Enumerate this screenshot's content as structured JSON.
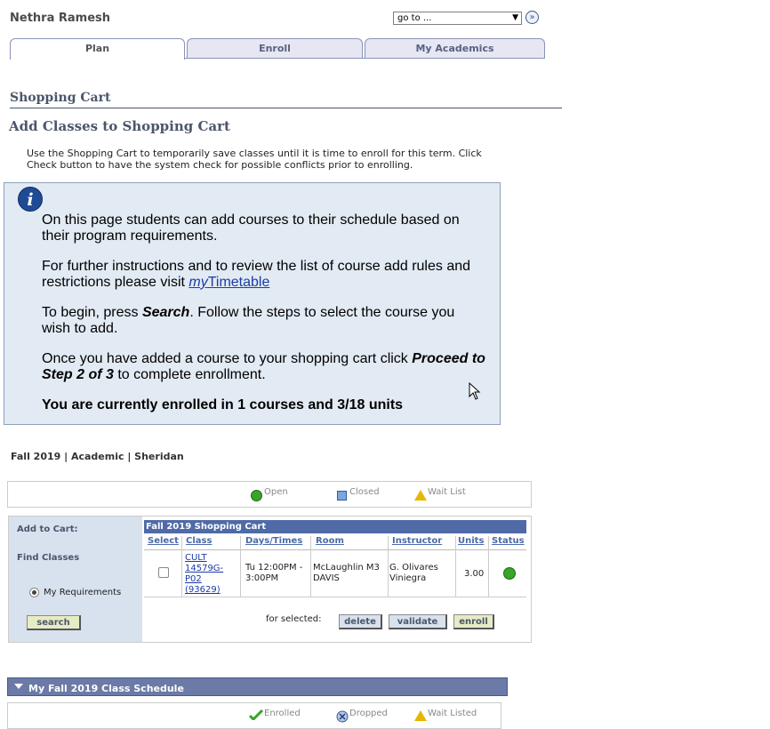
{
  "header": {
    "student_name": "Nethra Ramesh",
    "goto_label": "go to ...",
    "goto_button_glyph": "»"
  },
  "tabs": [
    {
      "label": "Plan",
      "active": true
    },
    {
      "label": "Enroll",
      "active": false
    },
    {
      "label": "My Academics",
      "active": false
    }
  ],
  "page": {
    "section_title": "Shopping Cart",
    "title": "Add Classes to Shopping Cart",
    "intro": "Use the Shopping Cart to temporarily save classes until it is time to enroll for this term.  Click Check button to have the system check for possible conflicts prior to enrolling."
  },
  "info": {
    "icon_glyph": "i",
    "p1": "On this page students can add courses to their schedule based on their program requirements.",
    "p2_before": "For further instructions and to review the list of course add rules and restrictions please visit ",
    "p2_link_italic": "my",
    "p2_link_rest": "Timetable",
    "p3_before": "To begin, press ",
    "p3_bold": "Search",
    "p3_after": ". Follow the steps to select the course you wish to add.",
    "p4_before": "Once you have added a course to your shopping cart click ",
    "p4_bold": "Proceed to Step 2 of 3",
    "p4_after": " to complete enrollment.",
    "p5": "You are currently enrolled in 1 courses and 3/18 units"
  },
  "term": "Fall 2019 | Academic | Sheridan",
  "legend": {
    "open": "Open",
    "closed": "Closed",
    "waitlist": "Wait List"
  },
  "sidebar": {
    "add_to_cart": "Add to Cart:",
    "find_classes": "Find Classes",
    "option": "My Requirements",
    "search": "search"
  },
  "cart": {
    "title": "Fall 2019 Shopping Cart",
    "headers": [
      "Select",
      "Class",
      "Days/Times",
      "Room",
      "Instructor",
      "Units",
      "Status"
    ],
    "row": {
      "class": "CULT 14579G-P02 (93629)",
      "days_times": "Tu 12:00PM - 3:00PM",
      "room": "McLaughlin M3 DAVIS",
      "instructor": "G. Olivares Viniegra",
      "units": "3.00",
      "status": "Open"
    },
    "for_selected": "for selected:",
    "delete": "delete",
    "validate": "validate",
    "enroll": "enroll"
  },
  "schedule": {
    "title": "My Fall 2019 Class Schedule",
    "legend": {
      "enrolled": "Enrolled",
      "dropped": "Dropped",
      "waitlisted": "Wait Listed"
    }
  },
  "colors": {
    "accent": "#4f6aa6",
    "open": "#3aa329",
    "closed": "#7aa7de",
    "waitlist": "#e5b700"
  }
}
